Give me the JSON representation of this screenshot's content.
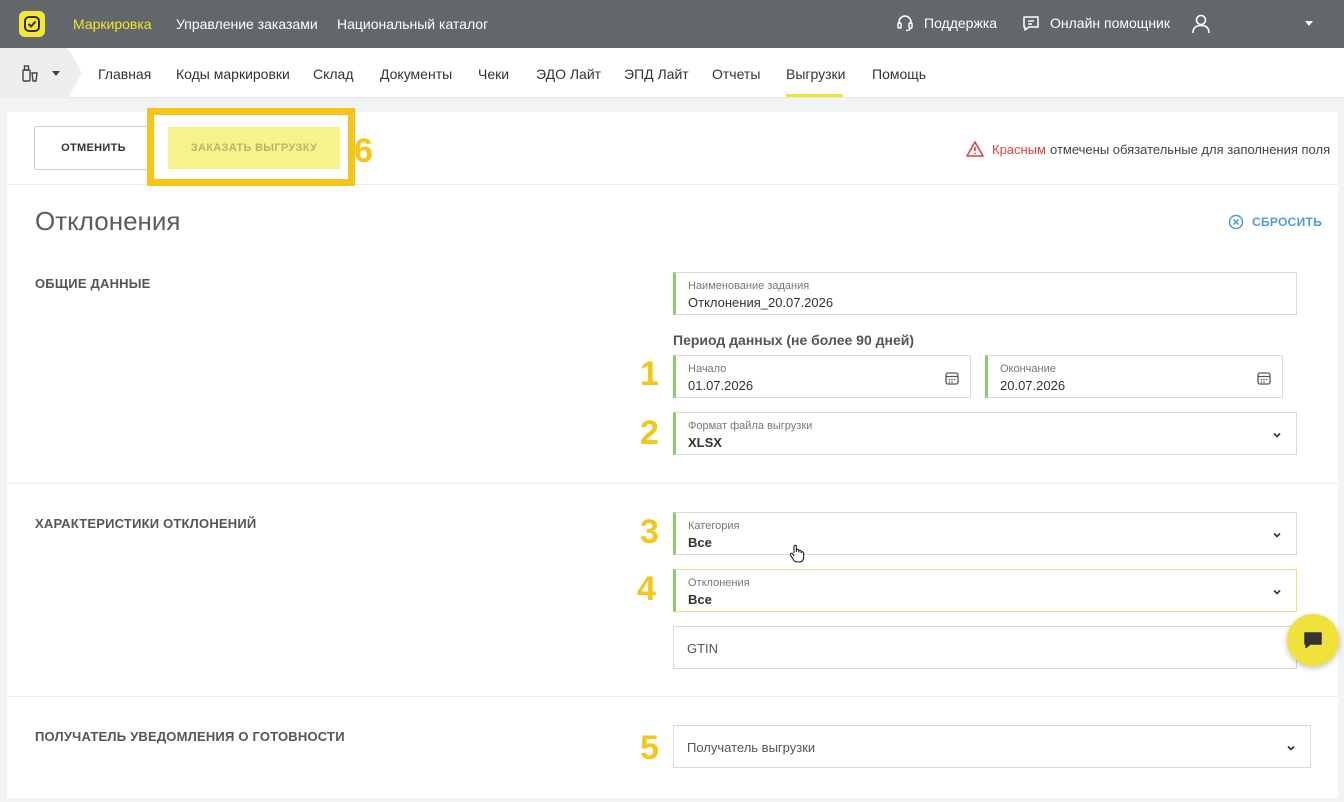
{
  "topbar": {
    "nav": [
      "Маркировка",
      "Управление заказами",
      "Национальный каталог"
    ],
    "support": "Поддержка",
    "assistant": "Онлайн помощник"
  },
  "subnav": {
    "items": [
      "Главная",
      "Коды маркировки",
      "Склад",
      "Документы",
      "Чеки",
      "ЭДО Лайт",
      "ЭПД Лайт",
      "Отчеты",
      "Выгрузки",
      "Помощь"
    ],
    "active": "Выгрузки"
  },
  "toolbar": {
    "cancel_label": "ОТМЕНИТЬ",
    "order_label": "ЗАКАЗАТЬ ВЫГРУЗКУ",
    "required_red": "Красным",
    "required_rest": "отмечены обязательные для заполнения поля"
  },
  "page": {
    "title": "Отклонения",
    "reset_label": "СБРОСИТЬ"
  },
  "general": {
    "section_label": "ОБЩИЕ ДАННЫЕ",
    "task_name_label": "Наименование задания",
    "task_name_value": "Отклонения_20.07.2026",
    "period_label": "Период данных (не более 90 дней)",
    "start_label": "Начало",
    "start_value": "01.07.2026",
    "end_label": "Окончание",
    "end_value": "20.07.2026",
    "format_label": "Формат файла выгрузки",
    "format_value": "XLSX"
  },
  "characteristics": {
    "section_label": "ХАРАКТЕРИСТИКИ ОТКЛОНЕНИЙ",
    "category_label": "Категория",
    "category_value": "Все",
    "deviations_label": "Отклонения",
    "deviations_value": "Все",
    "gtin_placeholder": "GTIN"
  },
  "recipient": {
    "section_label": "ПОЛУЧАТЕЛЬ УВЕДОМЛЕНИЯ О ГОТОВНОСТИ",
    "placeholder": "Получатель выгрузки"
  },
  "markers": [
    "1",
    "2",
    "3",
    "4",
    "5",
    "6"
  ],
  "colors": {
    "topbar": "#63666a",
    "accent_yellow": "#f4e532",
    "marker_yellow": "#f5c518",
    "required_border": "#8acc6a",
    "link_blue": "#4d9bd8",
    "error_red": "#e0413b"
  }
}
